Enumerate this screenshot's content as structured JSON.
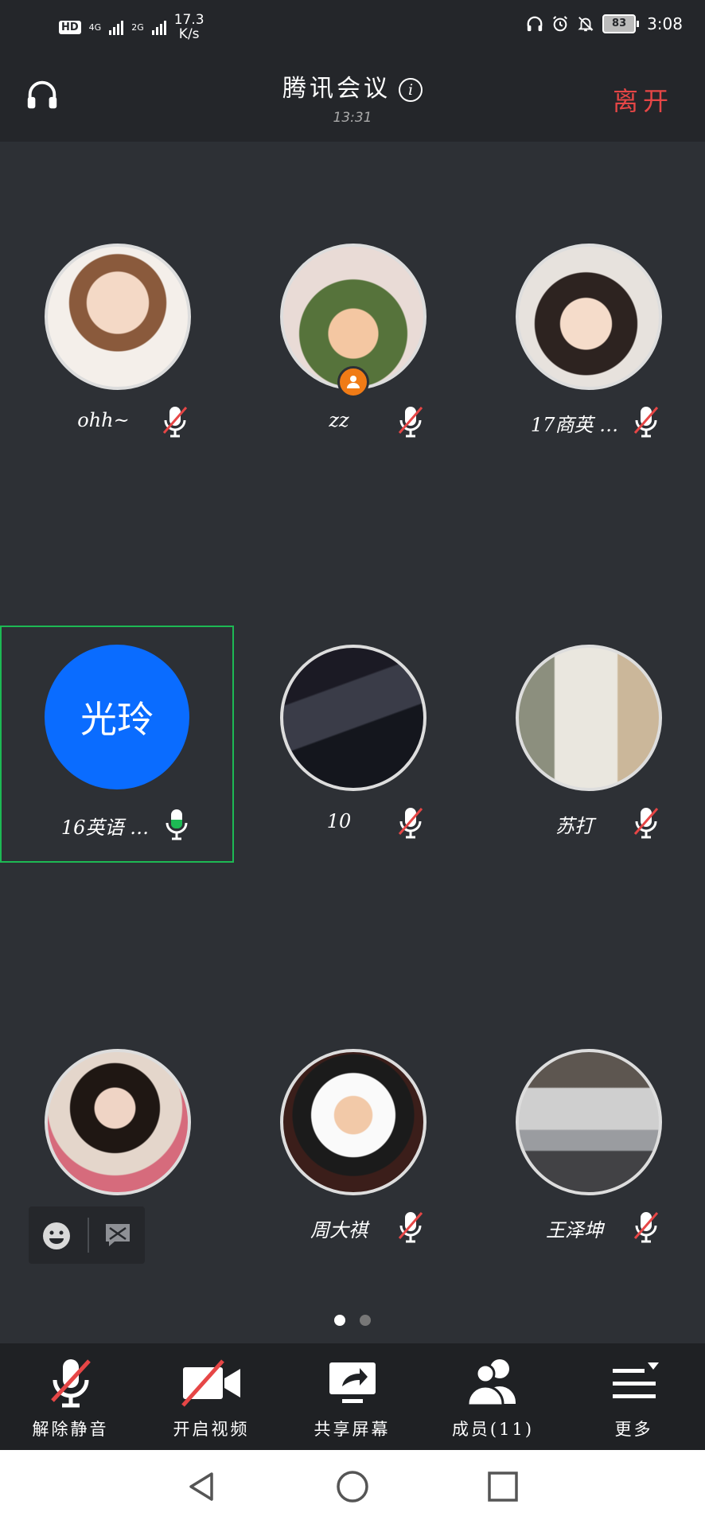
{
  "status_bar": {
    "network_1": "4G",
    "network_2": "2G",
    "speed_value": "17.3",
    "speed_unit": "K/s",
    "battery": "83",
    "time": "3:08"
  },
  "header": {
    "title": "腾讯会议",
    "timer": "13:31",
    "leave_label": "离开"
  },
  "participants": [
    {
      "name": "ohh~",
      "mic": "muted"
    },
    {
      "name": "zz",
      "mic": "muted",
      "host": true
    },
    {
      "name": "17商英 …",
      "mic": "muted"
    },
    {
      "name": "16英语 …",
      "mic": "active",
      "avatar_text": "光玲"
    },
    {
      "name": "10",
      "mic": "muted"
    },
    {
      "name": "苏打",
      "mic": "muted"
    },
    {
      "name": "",
      "mic": "none"
    },
    {
      "name": "周大祺",
      "mic": "muted"
    },
    {
      "name": "王泽坤",
      "mic": "muted"
    }
  ],
  "pager": {
    "total": 2,
    "current": 1
  },
  "toolbar": {
    "unmute_label": "解除静音",
    "video_label": "开启视频",
    "share_label": "共享屏幕",
    "members_label": "成员(11)",
    "more_label": "更多"
  },
  "colors": {
    "background": "#2d3035",
    "bar": "#24262a",
    "leave": "#e64646",
    "mute_slash": "#e64646",
    "speaking": "#1db954",
    "initials_avatar": "#0a6cff",
    "host_badge": "#f07b16"
  }
}
